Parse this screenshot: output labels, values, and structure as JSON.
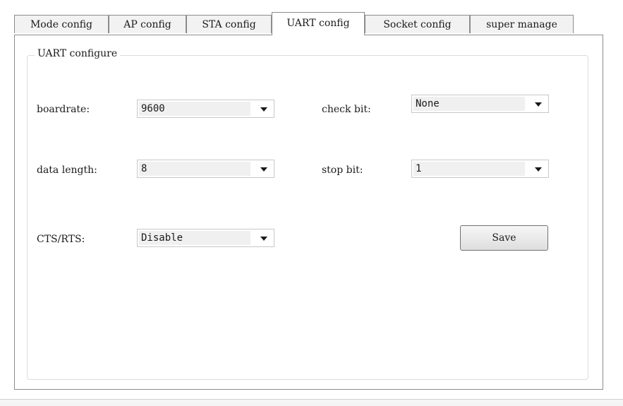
{
  "tabs": [
    {
      "label": "Mode config",
      "active": false
    },
    {
      "label": "AP config",
      "active": false
    },
    {
      "label": "STA config",
      "active": false
    },
    {
      "label": "UART config",
      "active": true
    },
    {
      "label": "Socket config",
      "active": false
    },
    {
      "label": "super manage",
      "active": false
    }
  ],
  "group": {
    "title": "UART configure"
  },
  "fields": {
    "baudrate": {
      "label": "boardrate:",
      "value": "9600"
    },
    "check_bit": {
      "label": "check bit:",
      "value": "None"
    },
    "data_length": {
      "label": "data length:",
      "value": "8"
    },
    "stop_bit": {
      "label": "stop bit:",
      "value": "1"
    },
    "cts_rts": {
      "label": "CTS/RTS:",
      "value": "Disable"
    }
  },
  "save_button": {
    "label": "Save"
  },
  "icons": {
    "dropdown": "chevron-down-icon"
  }
}
